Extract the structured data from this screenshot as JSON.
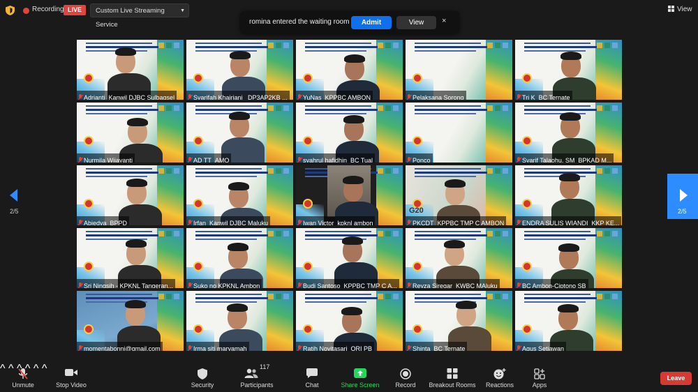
{
  "topbar": {
    "recording_label": "Recording",
    "live_label": "LIVE",
    "stream_service": "Custom Live Streaming Service",
    "view_label": "View"
  },
  "notification": {
    "message": "romina entered the waiting room",
    "admit_label": "Admit",
    "view_label": "View",
    "close_glyph": "×"
  },
  "gallery": {
    "page_left": "2/5",
    "page_right": "2/5",
    "participants": [
      {
        "name": "Adrianti_Kanwil DJBC Sulbagsel"
      },
      {
        "name": "Syarifah Khairiani_ DP3AP2KB ..."
      },
      {
        "name": "YuNas_KPPBC AMBON"
      },
      {
        "name": "Pelaksana Sorong"
      },
      {
        "name": "Tri K_BC Ternate"
      },
      {
        "name": "Nurmila Wijayanti"
      },
      {
        "name": "AD TT_AMQ"
      },
      {
        "name": "syahrul hafidhin_BC Tual"
      },
      {
        "name": "Ponco"
      },
      {
        "name": "Syarif Talaohu, SM_BPKAD M..."
      },
      {
        "name": "Abiedya_BPPD"
      },
      {
        "name": "Irfan_Kanwil DJBC Maluku"
      },
      {
        "name": "Iwan Victor_kpknl ambon"
      },
      {
        "name": "PKCDT_KPPBC TMP C AMBON"
      },
      {
        "name": "ENDRA SULIS WIANDI_KKP KE..."
      },
      {
        "name": "Sri Ningsih - KPKNL Tangeran..."
      },
      {
        "name": "Suko no KPKNL Ambon"
      },
      {
        "name": "Budi Santoso_KPPBC TMP C A..."
      },
      {
        "name": "Reyza Siregar_KWBC MAluku"
      },
      {
        "name": "BC Ambon-Ciptono SB"
      },
      {
        "name": "momentabonni@gmail.com"
      },
      {
        "name": "Irma siti maryamah"
      },
      {
        "name": "Ratih Novitasari_ORI PB"
      },
      {
        "name": "Shinta_BC Ternate"
      },
      {
        "name": "Agus Setiawan"
      }
    ],
    "g20_label": "G20"
  },
  "toolbar": {
    "unmute": "Unmute",
    "stop_video": "Stop Video",
    "security": "Security",
    "participants": "Participants",
    "participants_count": "117",
    "chat": "Chat",
    "share_screen": "Share Screen",
    "record": "Record",
    "breakout_rooms": "Breakout Rooms",
    "reactions": "Reactions",
    "apps": "Apps",
    "leave": "Leave"
  },
  "colors": {
    "accent_blue": "#0e71eb",
    "share_green": "#23d959",
    "live_red": "#e0443e",
    "leave_red": "#d63b33"
  }
}
